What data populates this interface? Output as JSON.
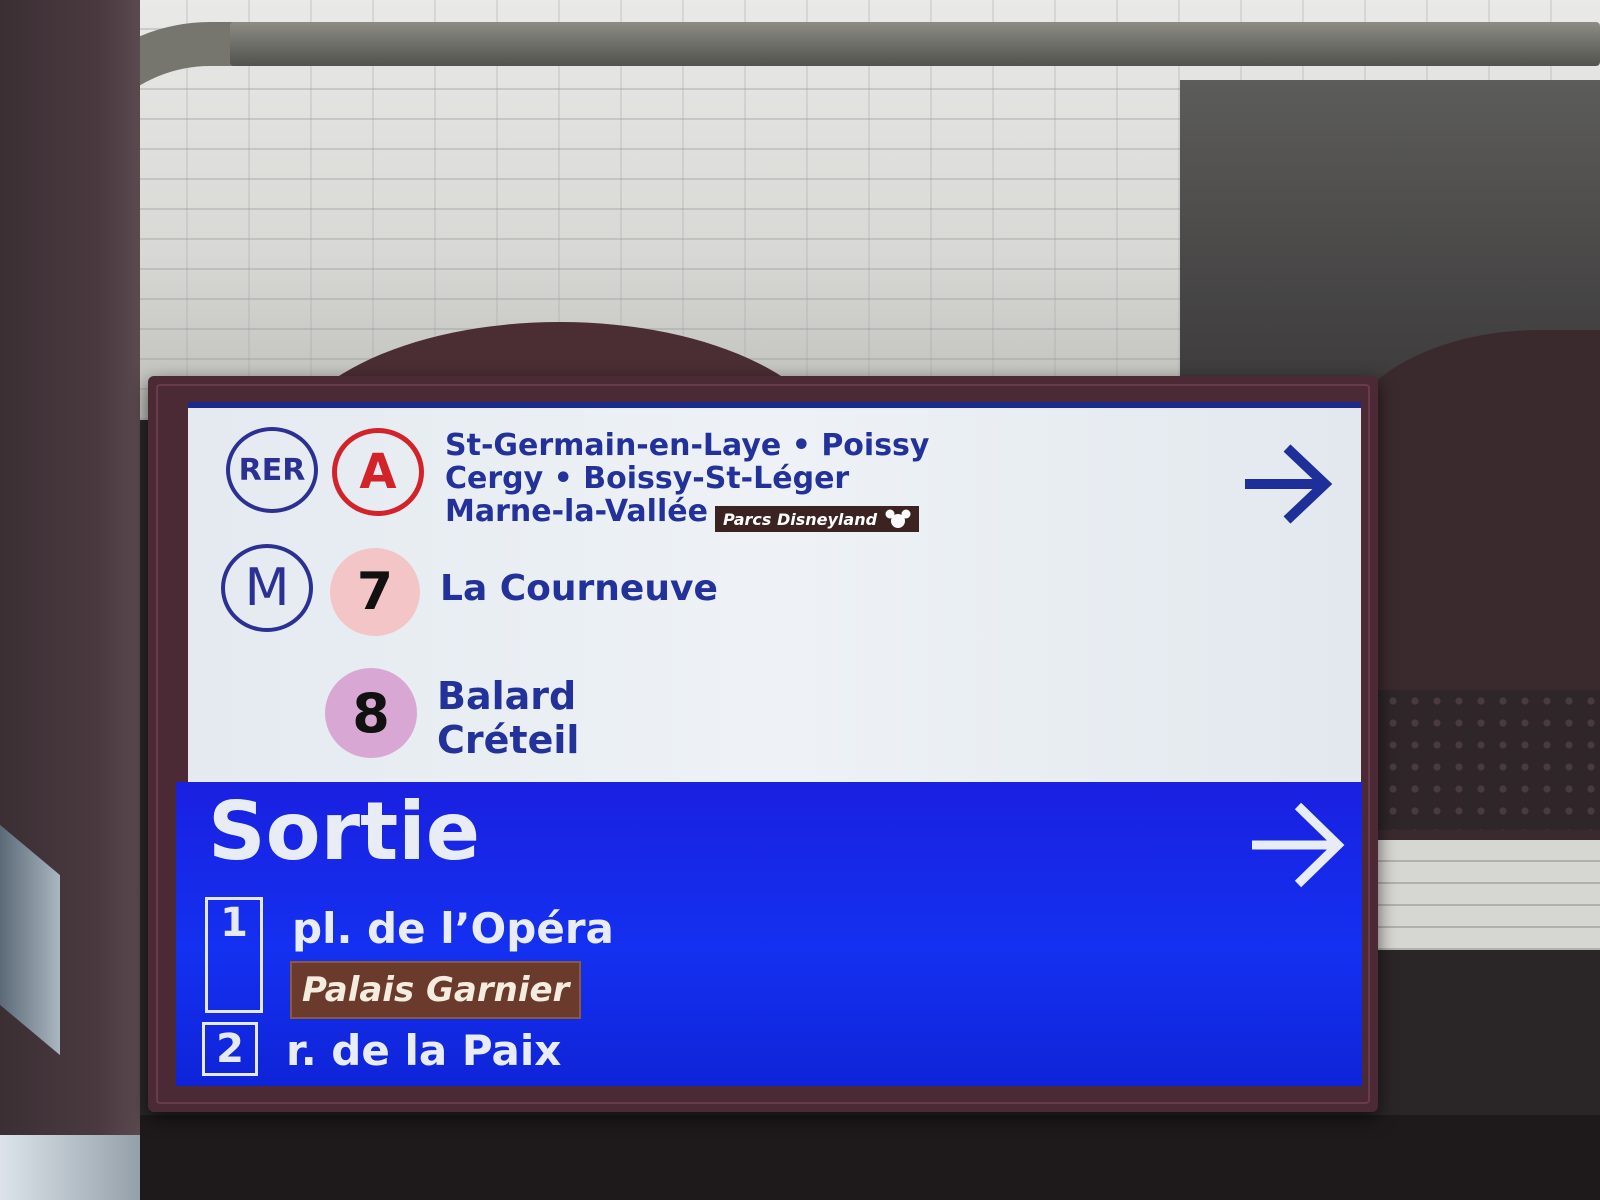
{
  "sign": {
    "rer": {
      "network_label": "RER",
      "line": "A",
      "destinations": [
        "St-Germain-en-Laye • Poissy",
        "Cergy • Boissy-St-Léger",
        "Marne-la-Vallée"
      ],
      "badge": "Parcs Disneyland",
      "badge_icon": "mickey-icon",
      "line_color": "#d2232a"
    },
    "metro": {
      "network_label": "M",
      "line_7": {
        "number": "7",
        "destination": "La Courneuve",
        "color": "#f4c5c7"
      },
      "line_8": {
        "number": "8",
        "destinations": [
          "Balard",
          "Créteil"
        ],
        "color": "#d9a7d4"
      }
    },
    "exit": {
      "title": "Sortie",
      "exits": [
        {
          "number": "1",
          "label": "pl. de l’Opéra",
          "badge": "Palais Garnier"
        },
        {
          "number": "2",
          "label": "r. de la Paix"
        }
      ]
    },
    "arrow_icon": "arrow-right-icon",
    "colors": {
      "ratp_blue": "#23329a",
      "exit_panel": "#1430f0"
    }
  }
}
